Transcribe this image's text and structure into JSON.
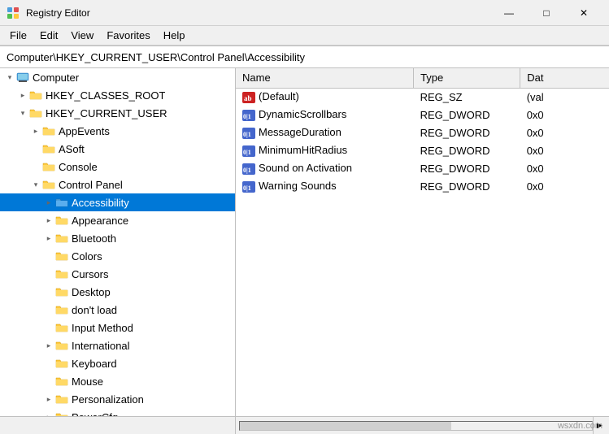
{
  "window": {
    "title": "Registry Editor",
    "icon": "registry-editor-icon"
  },
  "titlebar": {
    "minimize_label": "—",
    "maximize_label": "□",
    "close_label": "✕"
  },
  "menubar": {
    "items": [
      "File",
      "Edit",
      "View",
      "Favorites",
      "Help"
    ]
  },
  "address": {
    "path": "Computer\\HKEY_CURRENT_USER\\Control Panel\\Accessibility"
  },
  "tree": {
    "items": [
      {
        "id": "computer",
        "label": "Computer",
        "indent": 0,
        "expanded": true,
        "has_arrow": true,
        "arrow_expanded": true,
        "folder_type": "computer"
      },
      {
        "id": "hkey_classes_root",
        "label": "HKEY_CLASSES_ROOT",
        "indent": 1,
        "expanded": false,
        "has_arrow": true,
        "arrow_expanded": false,
        "folder_type": "yellow"
      },
      {
        "id": "hkey_current_user",
        "label": "HKEY_CURRENT_USER",
        "indent": 1,
        "expanded": true,
        "has_arrow": true,
        "arrow_expanded": true,
        "folder_type": "yellow"
      },
      {
        "id": "appevents",
        "label": "AppEvents",
        "indent": 2,
        "expanded": false,
        "has_arrow": true,
        "arrow_expanded": false,
        "folder_type": "yellow"
      },
      {
        "id": "asoft",
        "label": "ASoft",
        "indent": 2,
        "expanded": false,
        "has_arrow": false,
        "folder_type": "yellow"
      },
      {
        "id": "console",
        "label": "Console",
        "indent": 2,
        "expanded": false,
        "has_arrow": false,
        "folder_type": "yellow"
      },
      {
        "id": "control_panel",
        "label": "Control Panel",
        "indent": 2,
        "expanded": true,
        "has_arrow": true,
        "arrow_expanded": true,
        "folder_type": "yellow"
      },
      {
        "id": "accessibility",
        "label": "Accessibility",
        "indent": 3,
        "expanded": true,
        "has_arrow": true,
        "arrow_expanded": false,
        "folder_type": "blue",
        "selected": true
      },
      {
        "id": "appearance",
        "label": "Appearance",
        "indent": 3,
        "expanded": false,
        "has_arrow": true,
        "arrow_expanded": false,
        "folder_type": "yellow"
      },
      {
        "id": "bluetooth",
        "label": "Bluetooth",
        "indent": 3,
        "expanded": false,
        "has_arrow": true,
        "arrow_expanded": false,
        "folder_type": "yellow"
      },
      {
        "id": "colors",
        "label": "Colors",
        "indent": 3,
        "expanded": false,
        "has_arrow": false,
        "folder_type": "yellow"
      },
      {
        "id": "cursors",
        "label": "Cursors",
        "indent": 3,
        "expanded": false,
        "has_arrow": false,
        "folder_type": "yellow"
      },
      {
        "id": "desktop",
        "label": "Desktop",
        "indent": 3,
        "expanded": false,
        "has_arrow": false,
        "folder_type": "yellow"
      },
      {
        "id": "dontload",
        "label": "don't load",
        "indent": 3,
        "expanded": false,
        "has_arrow": false,
        "folder_type": "yellow"
      },
      {
        "id": "inputmethod",
        "label": "Input Method",
        "indent": 3,
        "expanded": false,
        "has_arrow": false,
        "folder_type": "yellow"
      },
      {
        "id": "international",
        "label": "International",
        "indent": 3,
        "expanded": false,
        "has_arrow": true,
        "arrow_expanded": false,
        "folder_type": "yellow"
      },
      {
        "id": "keyboard",
        "label": "Keyboard",
        "indent": 3,
        "expanded": false,
        "has_arrow": false,
        "folder_type": "yellow"
      },
      {
        "id": "mouse",
        "label": "Mouse",
        "indent": 3,
        "expanded": false,
        "has_arrow": false,
        "folder_type": "yellow"
      },
      {
        "id": "personalization",
        "label": "Personalization",
        "indent": 3,
        "expanded": false,
        "has_arrow": true,
        "arrow_expanded": false,
        "folder_type": "yellow"
      },
      {
        "id": "powercfg",
        "label": "PowerCfg",
        "indent": 3,
        "expanded": false,
        "has_arrow": true,
        "arrow_expanded": false,
        "folder_type": "yellow"
      }
    ]
  },
  "registry_values": {
    "columns": [
      "Name",
      "Type",
      "Data"
    ],
    "rows": [
      {
        "name": "(Default)",
        "type": "REG_SZ",
        "data": "(val",
        "icon": "ab-icon"
      },
      {
        "name": "DynamicScrollbars",
        "type": "REG_DWORD",
        "data": "0x0",
        "icon": "dword-icon"
      },
      {
        "name": "MessageDuration",
        "type": "REG_DWORD",
        "data": "0x0",
        "icon": "dword-icon"
      },
      {
        "name": "MinimumHitRadius",
        "type": "REG_DWORD",
        "data": "0x0",
        "icon": "dword-icon"
      },
      {
        "name": "Sound on Activation",
        "type": "REG_DWORD",
        "data": "0x0",
        "icon": "dword-icon"
      },
      {
        "name": "Warning Sounds",
        "type": "REG_DWORD",
        "data": "0x0",
        "icon": "dword-icon"
      }
    ]
  },
  "watermark": "wsxdn.com"
}
